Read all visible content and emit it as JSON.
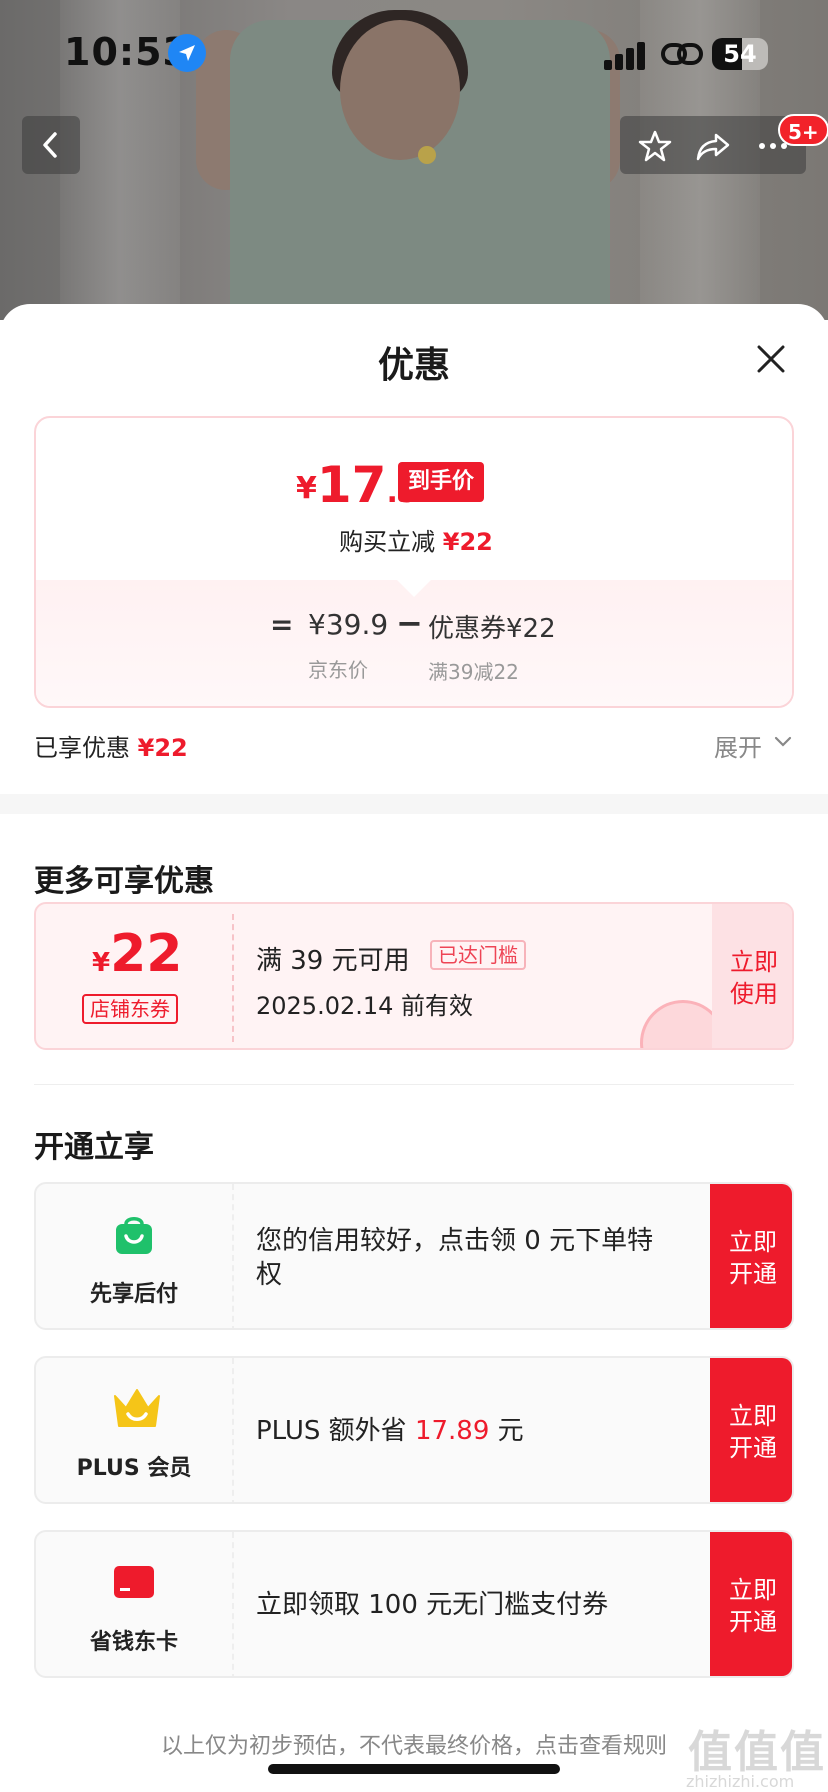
{
  "status_bar": {
    "time": "10:53",
    "battery": "54"
  },
  "nav": {
    "badge": "5+"
  },
  "sheet": {
    "title": "优惠",
    "price": {
      "currency": "¥",
      "integer": "17",
      "decimal": ".9",
      "tag": "到手价",
      "reduce_label": "购买立减",
      "reduce_value": "¥22",
      "eq": "=",
      "jd_price": "¥39.9",
      "minus": "−",
      "coupon_label": "优惠券¥22",
      "jd_price_label": "京东价",
      "coupon_sub": "满39减22"
    },
    "enjoyed": {
      "label": "已享优惠",
      "value": "¥22",
      "expand": "展开"
    },
    "more_title": "更多可享优惠",
    "coupon": {
      "currency": "¥",
      "amount": "22",
      "type": "店铺东券",
      "condition": "满 39 元可用",
      "reached": "已达门槛",
      "validity": "2025.02.14 前有效",
      "use_line1": "立即",
      "use_line2": "使用"
    },
    "open_title": "开通立享",
    "services": [
      {
        "name": "先享后付",
        "desc": "您的信用较好，点击领 0 元下单特权",
        "btn1": "立即",
        "btn2": "开通",
        "icon": "shopping-bag-icon"
      },
      {
        "name": "PLUS 会员",
        "desc_pre": "PLUS 额外省 ",
        "desc_num": "17.89",
        "desc_post": " 元",
        "btn1": "立即",
        "btn2": "开通",
        "icon": "crown-icon"
      },
      {
        "name": "省钱东卡",
        "desc": "立即领取 100 元无门槛支付券",
        "btn1": "立即",
        "btn2": "开通",
        "icon": "card-icon"
      }
    ],
    "footer": "以上仅为初步预估，不代表最终价格，点击查看规则"
  },
  "watermark": {
    "big": "值值值",
    "small": "zhizhizhi.com"
  },
  "colors": {
    "accent": "#ee1b2c",
    "pink_bg": "#fff3f4",
    "green": "#1fc16b",
    "gold": "#f5c518"
  }
}
